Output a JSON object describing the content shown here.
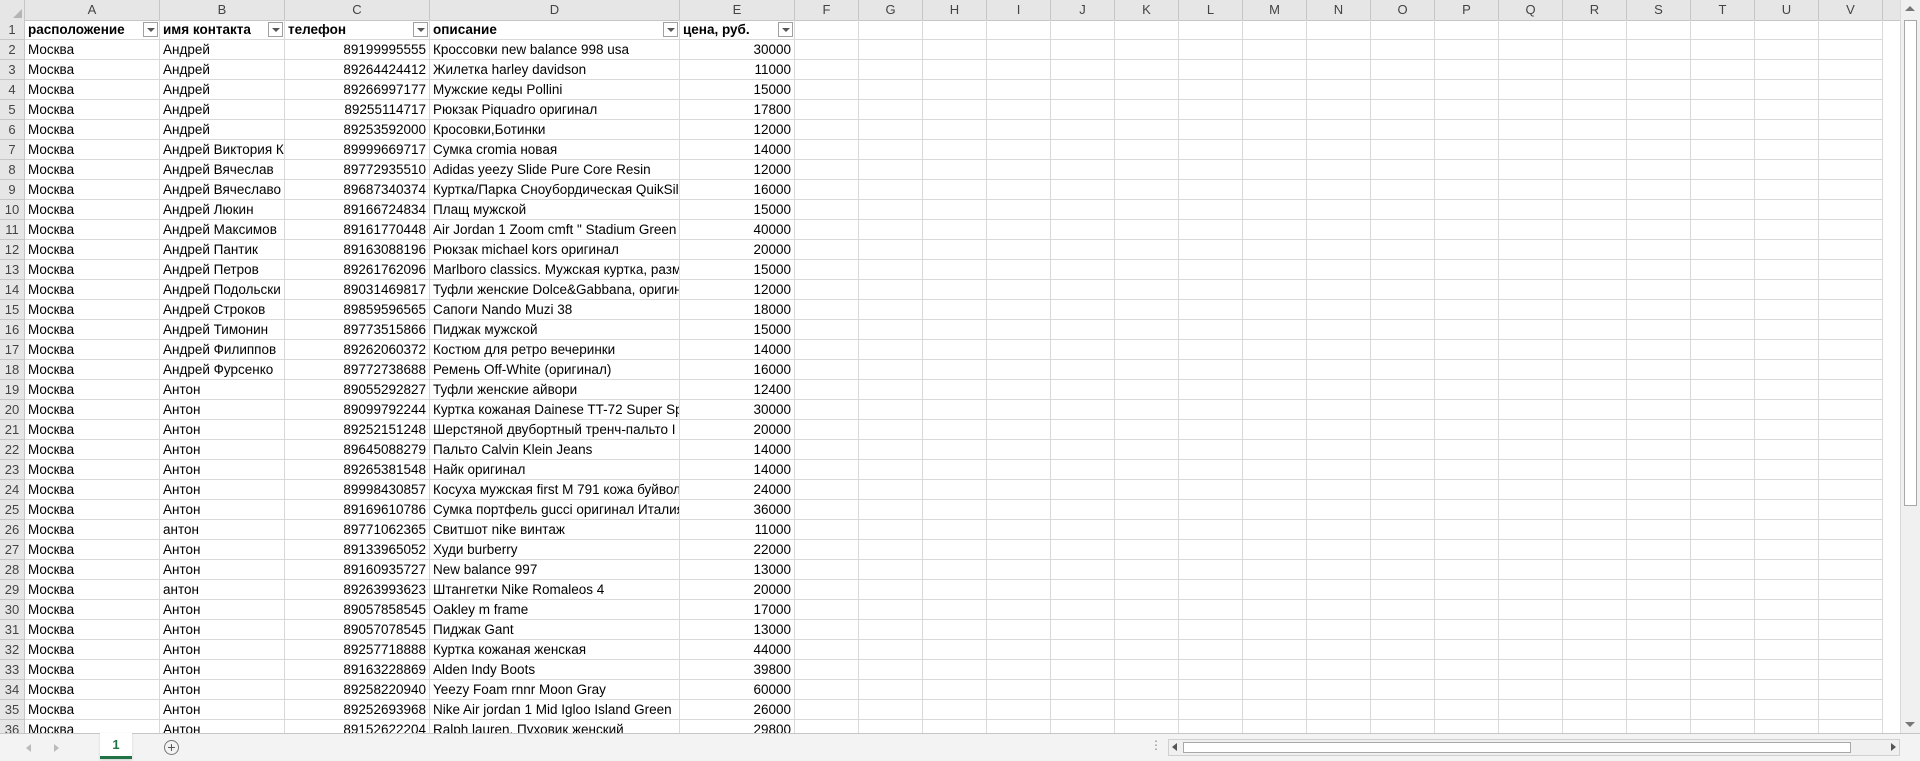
{
  "columns": [
    "A",
    "B",
    "C",
    "D",
    "E",
    "F",
    "G",
    "H",
    "I",
    "J",
    "K",
    "L",
    "M",
    "N",
    "O",
    "P",
    "Q",
    "R",
    "S",
    "T",
    "U",
    "V"
  ],
  "header_row": {
    "row_number": "1",
    "cells": [
      "расположение",
      "имя контакта",
      "телефон",
      "описание",
      "цена, руб."
    ]
  },
  "rows": [
    {
      "n": "2",
      "loc": "Москва",
      "name": "Андрей",
      "phone": "89199995555",
      "desc": "Кроссовки new balance 998 usa",
      "price": "30000"
    },
    {
      "n": "3",
      "loc": "Москва",
      "name": "Андрей",
      "phone": "89264424412",
      "desc": "Жилетка harley davidson",
      "price": "11000"
    },
    {
      "n": "4",
      "loc": "Москва",
      "name": "Андрей",
      "phone": "89266997177",
      "desc": "Мужские кеды Pollini",
      "price": "15000"
    },
    {
      "n": "5",
      "loc": "Москва",
      "name": "Андрей",
      "phone": "89255114717",
      "desc": "Рюкзак Piquadro оригинал",
      "price": "17800"
    },
    {
      "n": "6",
      "loc": "Москва",
      "name": "Андрей",
      "phone": "89253592000",
      "desc": "Кросовки,Ботинки",
      "price": "12000"
    },
    {
      "n": "7",
      "loc": "Москва",
      "name": "Андрей Виктория К",
      "phone": "89999669717",
      "desc": "Сумка cromia новая",
      "price": "14000"
    },
    {
      "n": "8",
      "loc": "Москва",
      "name": "Андрей Вячеслав",
      "phone": "89772935510",
      "desc": "Adidas yeezy Slide Pure Core Resin",
      "price": "12000"
    },
    {
      "n": "9",
      "loc": "Москва",
      "name": "Андрей Вячеславо",
      "phone": "89687340374",
      "desc": "Куртка/Парка Сноубордическая QuikSil",
      "price": "16000"
    },
    {
      "n": "10",
      "loc": "Москва",
      "name": "Андрей Люкин",
      "phone": "89166724834",
      "desc": "Плащ мужской",
      "price": "15000"
    },
    {
      "n": "11",
      "loc": "Москва",
      "name": "Андрей Максимов",
      "phone": "89161770448",
      "desc": "Air Jordan 1 Zoom cmft \" Stadium Green",
      "price": "40000"
    },
    {
      "n": "12",
      "loc": "Москва",
      "name": "Андрей Пантик",
      "phone": "89163088196",
      "desc": "Рюкзак michael kors оригинал",
      "price": "20000"
    },
    {
      "n": "13",
      "loc": "Москва",
      "name": "Андрей Петров",
      "phone": "89261762096",
      "desc": "Marlboro classics. Мужская куртка, разм",
      "price": "15000"
    },
    {
      "n": "14",
      "loc": "Москва",
      "name": "Андрей Подольски",
      "phone": "89031469817",
      "desc": "Туфли женские Dolce&Gabbana, оригин",
      "price": "12000"
    },
    {
      "n": "15",
      "loc": "Москва",
      "name": "Андрей Строков",
      "phone": "89859596565",
      "desc": "Сапоги Nando Muzi 38",
      "price": "18000"
    },
    {
      "n": "16",
      "loc": "Москва",
      "name": "Андрей Тимонин",
      "phone": "89773515866",
      "desc": "Пиджак мужской",
      "price": "15000"
    },
    {
      "n": "17",
      "loc": "Москва",
      "name": "Андрей Филиппов",
      "phone": "89262060372",
      "desc": "Костюм для ретро вечеринки",
      "price": "14000"
    },
    {
      "n": "18",
      "loc": "Москва",
      "name": "Андрей Фурсенко",
      "phone": "89772738688",
      "desc": "Ремень Off-White (оригинал)",
      "price": "16000"
    },
    {
      "n": "19",
      "loc": "Москва",
      "name": "Антон",
      "phone": "89055292827",
      "desc": "Туфли женские айвори",
      "price": "12400"
    },
    {
      "n": "20",
      "loc": "Москва",
      "name": "Антон",
      "phone": "89099792244",
      "desc": "Куртка кожаная Dainese TT-72 Super Sp",
      "price": "30000"
    },
    {
      "n": "21",
      "loc": "Москва",
      "name": "Антон",
      "phone": "89252151248",
      "desc": "Шерстяной двубортный тренч-пальто I",
      "price": "20000"
    },
    {
      "n": "22",
      "loc": "Москва",
      "name": "Антон",
      "phone": "89645088279",
      "desc": "Пальто Calvin Klein Jeans",
      "price": "14000"
    },
    {
      "n": "23",
      "loc": "Москва",
      "name": "Антон",
      "phone": "89265381548",
      "desc": "Найк оригинал",
      "price": "14000"
    },
    {
      "n": "24",
      "loc": "Москва",
      "name": "Антон",
      "phone": "89998430857",
      "desc": "Косуха мужская first M 791 кожа буйвол",
      "price": "24000"
    },
    {
      "n": "25",
      "loc": "Москва",
      "name": "Антон",
      "phone": "89169610786",
      "desc": "Сумка портфель gucci оригинал Италия",
      "price": "36000"
    },
    {
      "n": "26",
      "loc": "Москва",
      "name": "антон",
      "phone": "89771062365",
      "desc": "Свитшот nike винтаж",
      "price": "11000"
    },
    {
      "n": "27",
      "loc": "Москва",
      "name": "Антон",
      "phone": "89133965052",
      "desc": "Худи burberry",
      "price": "22000"
    },
    {
      "n": "28",
      "loc": "Москва",
      "name": "Антон",
      "phone": "89160935727",
      "desc": "New balance 997",
      "price": "13000"
    },
    {
      "n": "29",
      "loc": "Москва",
      "name": "антон",
      "phone": "89263993623",
      "desc": "Штангетки Nike Romaleos 4",
      "price": "20000"
    },
    {
      "n": "30",
      "loc": "Москва",
      "name": "Антон",
      "phone": "89057858545",
      "desc": "Oakley m frame",
      "price": "17000"
    },
    {
      "n": "31",
      "loc": "Москва",
      "name": "Антон",
      "phone": "89057078545",
      "desc": "Пиджак Gant",
      "price": "13000"
    },
    {
      "n": "32",
      "loc": "Москва",
      "name": "Антон",
      "phone": "89257718888",
      "desc": "Куртка кожаная женская",
      "price": "44000"
    },
    {
      "n": "33",
      "loc": "Москва",
      "name": "Антон",
      "phone": "89163228869",
      "desc": "Alden Indy Boots",
      "price": "39800"
    },
    {
      "n": "34",
      "loc": "Москва",
      "name": "Антон",
      "phone": "89258220940",
      "desc": "Yeezy Foam rnnr Moon Gray",
      "price": "60000"
    },
    {
      "n": "35",
      "loc": "Москва",
      "name": "Антон",
      "phone": "89252693968",
      "desc": "Nike Air jordan 1 Mid Igloo Island Green",
      "price": "26000"
    },
    {
      "n": "36",
      "loc": "Москва",
      "name": "Антон",
      "phone": "89152622204",
      "desc": "Ralph lauren. Пуховик женский",
      "price": "29800"
    }
  ],
  "sheet_tabs": [
    {
      "label": "1"
    }
  ],
  "add_sheet_label": "+",
  "colors": {
    "accent": "#217346",
    "grid": "#d9d9d9",
    "header_bg": "#e6e6e6"
  }
}
